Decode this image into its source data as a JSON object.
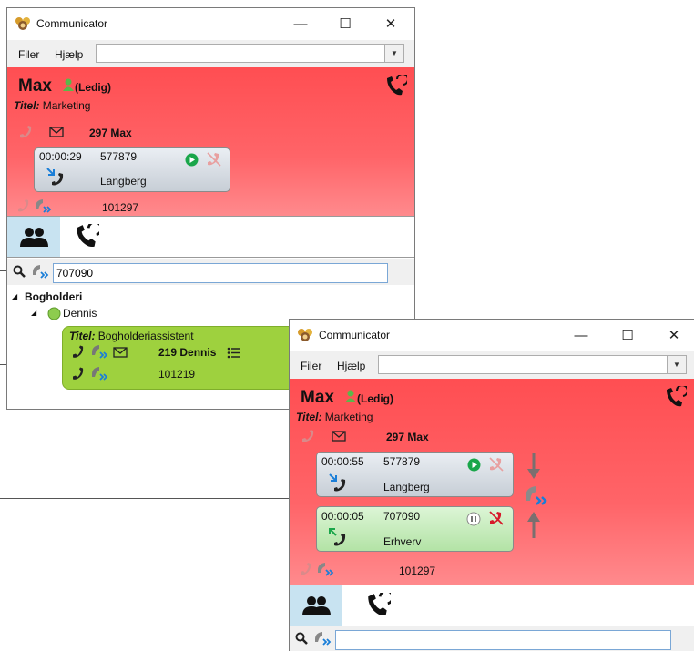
{
  "windows": [
    {
      "title": "Communicator",
      "menu": [
        "Filer",
        "Hjælp"
      ],
      "user": {
        "name": "Max",
        "status": "(Ledig)",
        "title_label": "Titel:",
        "title_value": "Marketing",
        "extension_label": "297 Max",
        "number": "101297"
      },
      "calls": [
        {
          "duration": "00:00:29",
          "number": "577879",
          "name": "Langberg",
          "direction": "incoming"
        }
      ],
      "tabs": [
        "contacts",
        "call-history"
      ],
      "search_value": "707090",
      "tree": {
        "group": "Bogholderi",
        "contact": "Dennis",
        "card": {
          "title_label": "Titel:",
          "title_value": "Bogholderiassistent",
          "extension_label": "219 Dennis",
          "number": "101219"
        }
      }
    },
    {
      "title": "Communicator",
      "menu": [
        "Filer",
        "Hjælp"
      ],
      "user": {
        "name": "Max",
        "status": "(Ledig)",
        "title_label": "Titel:",
        "title_value": "Marketing",
        "extension_label": "297 Max",
        "number": "101297"
      },
      "calls": [
        {
          "duration": "00:00:55",
          "number": "577879",
          "name": "Langberg",
          "direction": "incoming"
        },
        {
          "duration": "00:00:05",
          "number": "707090",
          "name": "Erhverv",
          "direction": "outgoing"
        }
      ],
      "tabs": [
        "contacts",
        "call-history"
      ],
      "search_value": ""
    }
  ],
  "colors": {
    "busy_panel": "#ff5a5e",
    "contact_card": "#9ed13e",
    "active_tab": "#c8e3f1",
    "play": "#1aa64a",
    "hangup": "#d7192a",
    "transfer_blue": "#1a7ed8",
    "arrow_grey": "#7a6f6f"
  }
}
